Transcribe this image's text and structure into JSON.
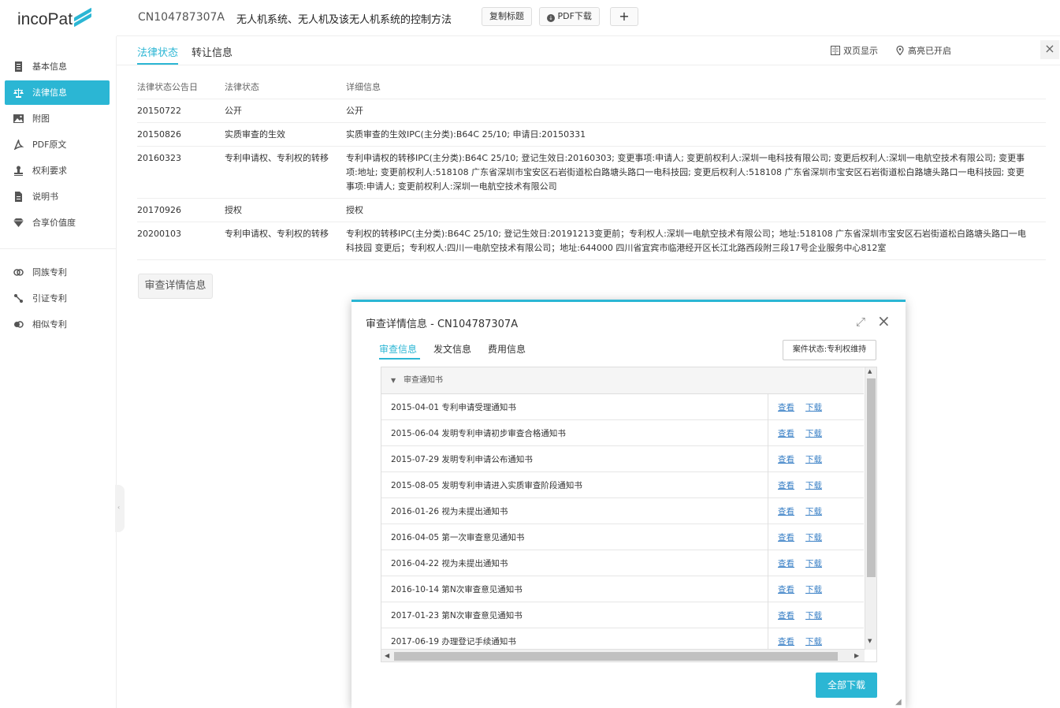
{
  "app": {
    "logo_text": "incoPat"
  },
  "header": {
    "patent_no": "CN104787307A",
    "title": "无人机系统、无人机及该无人机系统的控制方法",
    "copy_title": "复制标题",
    "pdf_download": "PDF下载",
    "add": "+"
  },
  "sidebar": {
    "items": [
      {
        "label": "基本信息",
        "icon": "document-icon"
      },
      {
        "label": "法律信息",
        "icon": "scales-icon",
        "active": true
      },
      {
        "label": "附图",
        "icon": "image-icon"
      },
      {
        "label": "PDF原文",
        "icon": "pdf-icon"
      },
      {
        "label": "权利要求",
        "icon": "stamp-icon"
      },
      {
        "label": "说明书",
        "icon": "page-icon"
      },
      {
        "label": "合享价值度",
        "icon": "diamond-icon"
      },
      {
        "label": "同族专利",
        "icon": "family-icon"
      },
      {
        "label": "引证专利",
        "icon": "citation-icon"
      },
      {
        "label": "相似专利",
        "icon": "similar-icon"
      }
    ]
  },
  "tabs": {
    "items": [
      "法律状态",
      "转让信息"
    ],
    "active": "法律状态",
    "double_page": "双页显示",
    "highlight": "高亮已开启",
    "close": "×"
  },
  "legal_table": {
    "headers": [
      "法律状态公告日",
      "法律状态",
      "详细信息"
    ],
    "rows": [
      {
        "date": "20150722",
        "status": "公开",
        "detail": "公开"
      },
      {
        "date": "20150826",
        "status": "实质审查的生效",
        "detail": "实质审查的生效IPC(主分类):B64C 25/10; 申请日:20150331"
      },
      {
        "date": "20160323",
        "status": "专利申请权、专利权的转移",
        "detail": "专利申请权的转移IPC(主分类):B64C 25/10; 登记生效日:20160303; 变更事项:申请人; 变更前权利人:深圳一电科技有限公司; 变更后权利人:深圳一电航空技术有限公司; 变更事项:地址; 变更前权利人:518108 广东省深圳市宝安区石岩街道松白路塘头路口一电科技园; 变更后权利人:518108 广东省深圳市宝安区石岩街道松白路塘头路口一电科技园; 变更事项:申请人; 变更前权利人:深圳一电航空技术有限公司"
      },
      {
        "date": "20170926",
        "status": "授权",
        "detail": "授权"
      },
      {
        "date": "20200103",
        "status": "专利申请权、专利权的转移",
        "detail": "专利权的转移IPC(主分类):B64C 25/10; 登记生效日:20191213变更前；专利权人:深圳一电航空技术有限公司；地址:518108 广东省深圳市宝安区石岩街道松白路塘头路口一电科技园 变更后；专利权人:四川一电航空技术有限公司；地址:644000 四川省宜宾市临港经开区长江北路西段附三段17号企业服务中心812室"
      }
    ]
  },
  "exam_button": "审查详情信息",
  "modal": {
    "title": "审查详情信息 - CN104787307A",
    "tabs": [
      "审查信息",
      "发文信息",
      "费用信息"
    ],
    "active_tab": "审查信息",
    "case_status": "案件状态:专利权维持",
    "group_label": "审查通知书",
    "view_label": "查看",
    "download_label": "下载",
    "rows": [
      "2015-04-01 专利申请受理通知书",
      "2015-06-04 发明专利申请初步审查合格通知书",
      "2015-07-29 发明专利申请公布通知书",
      "2015-08-05 发明专利申请进入实质审查阶段通知书",
      "2016-01-26 视为未提出通知书",
      "2016-04-05 第一次审查意见通知书",
      "2016-04-22 视为未提出通知书",
      "2016-10-14 第N次审查意见通知书",
      "2017-01-23 第N次审查意见通知书",
      "2017-06-19 办理登记手续通知书"
    ],
    "download_all": "全部下载"
  },
  "colors": {
    "accent": "#2bb6d4",
    "link": "#3a80c6"
  }
}
